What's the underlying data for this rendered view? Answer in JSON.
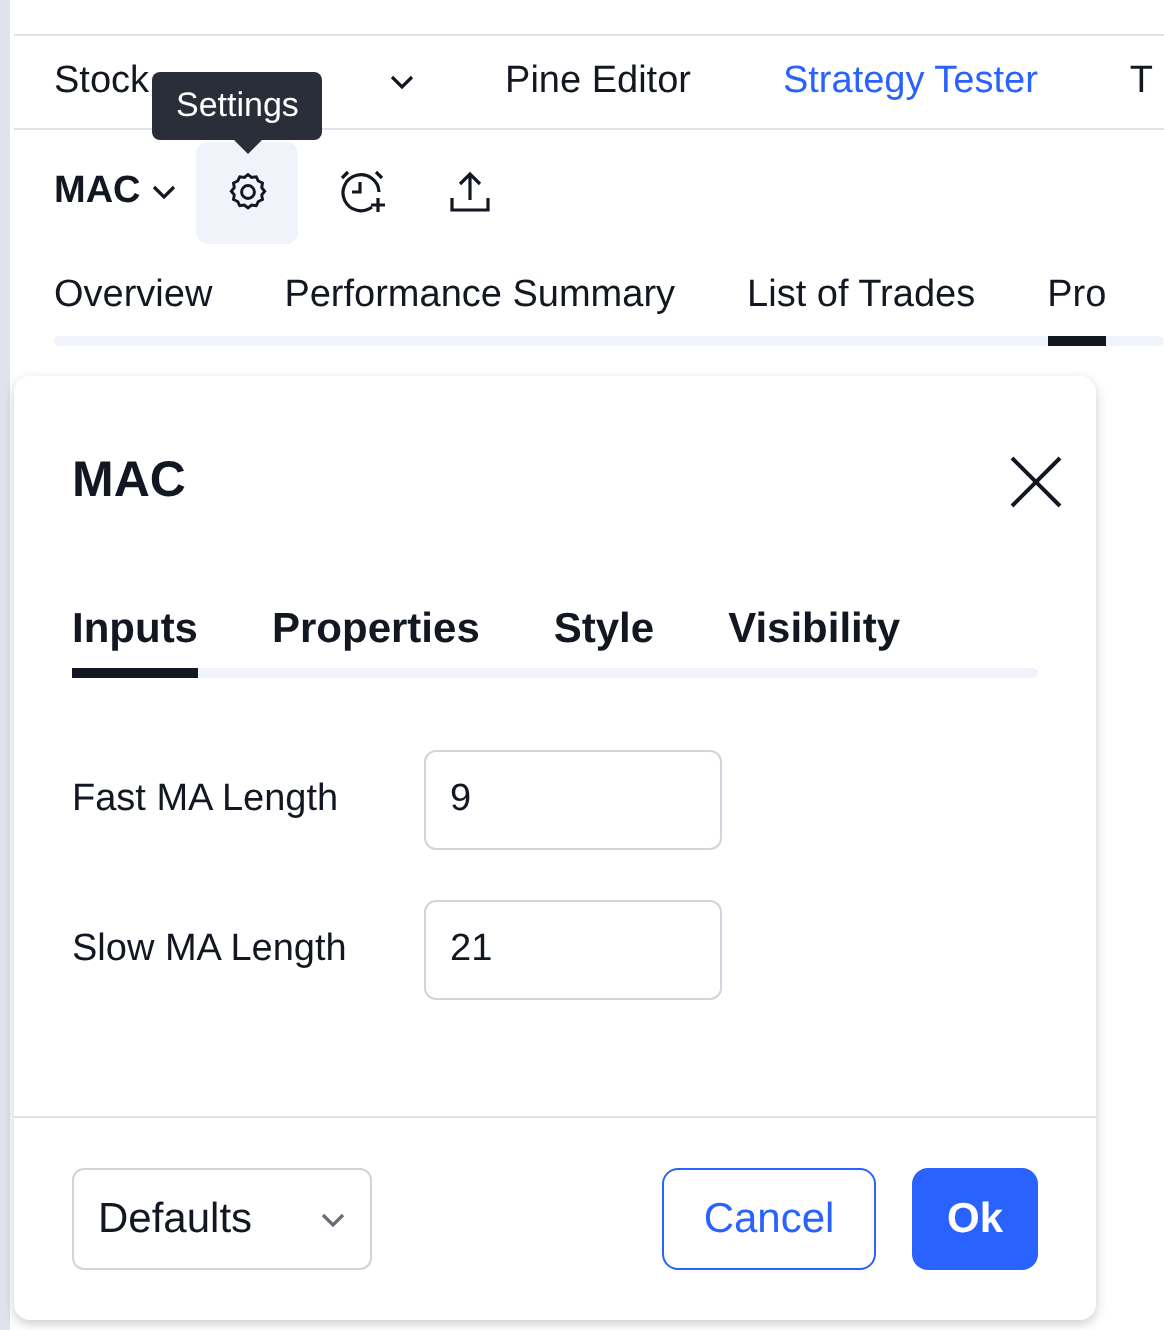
{
  "top_nav": [
    {
      "label": "Stock",
      "has_menu": true,
      "selected": false
    },
    {
      "label": "Pine Editor",
      "has_menu": false,
      "selected": false
    },
    {
      "label": "Strategy Tester",
      "has_menu": false,
      "selected": true
    },
    {
      "label": "T",
      "has_menu": false,
      "selected": false
    }
  ],
  "toolbar": {
    "strategy": "MAC",
    "tooltip": "Settings"
  },
  "report_tabs": [
    {
      "label": "Overview",
      "selected": false
    },
    {
      "label": "Performance Summary",
      "selected": false
    },
    {
      "label": "List of Trades",
      "selected": false
    },
    {
      "label": "Pro",
      "selected": true
    }
  ],
  "dialog": {
    "title": "MAC",
    "tabs": [
      {
        "label": "Inputs",
        "selected": true
      },
      {
        "label": "Properties",
        "selected": false
      },
      {
        "label": "Style",
        "selected": false
      },
      {
        "label": "Visibility",
        "selected": false
      }
    ],
    "inputs": [
      {
        "label": "Fast MA Length",
        "value": "9"
      },
      {
        "label": "Slow MA Length",
        "value": "21"
      }
    ],
    "defaults": "Defaults",
    "cancel": "Cancel",
    "ok": "Ok"
  }
}
